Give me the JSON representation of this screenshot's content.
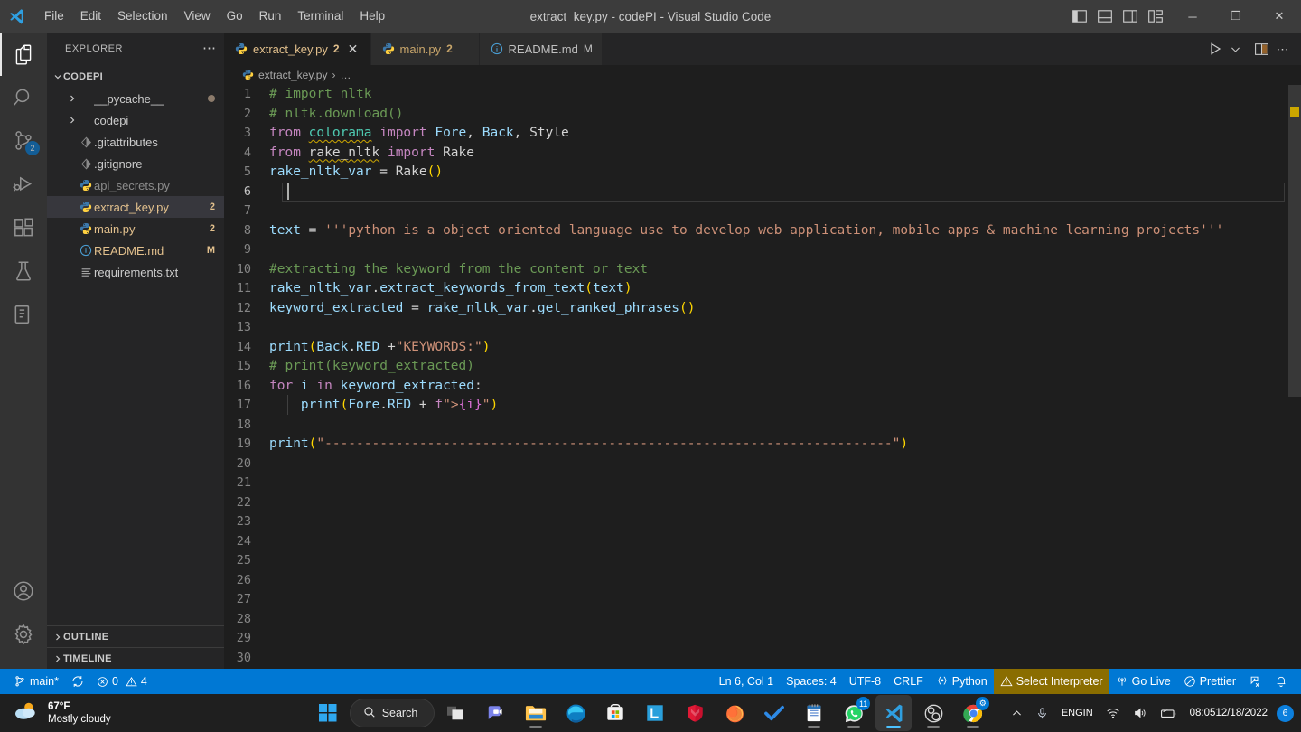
{
  "titlebar": {
    "logo_icon": "vscode-logo-icon",
    "menus": [
      "File",
      "Edit",
      "Selection",
      "View",
      "Go",
      "Run",
      "Terminal",
      "Help"
    ],
    "window_title": "extract_key.py - codePI - Visual Studio Code",
    "layout_controls": [
      {
        "name": "toggle-primary-sidebar-icon",
        "title": "Toggle Primary Side Bar"
      },
      {
        "name": "toggle-panel-icon",
        "title": "Toggle Panel"
      },
      {
        "name": "toggle-secondary-sidebar-icon",
        "title": "Toggle Secondary Side Bar"
      },
      {
        "name": "customize-layout-icon",
        "title": "Customize Layout"
      }
    ],
    "window_buttons": {
      "minimize": "─",
      "maximize": "❐",
      "close": "✕"
    }
  },
  "activitybar": {
    "items": [
      {
        "name": "explorer",
        "icon": "files-icon",
        "active": true,
        "badge": ""
      },
      {
        "name": "search",
        "icon": "search-icon",
        "active": false,
        "badge": ""
      },
      {
        "name": "source-control",
        "icon": "source-control-icon",
        "active": false,
        "badge": "2"
      },
      {
        "name": "run-and-debug",
        "icon": "run-debug-icon",
        "active": false,
        "badge": ""
      },
      {
        "name": "extensions",
        "icon": "extensions-icon",
        "active": false,
        "badge": ""
      },
      {
        "name": "testing",
        "icon": "testing-flask-icon",
        "active": false,
        "badge": ""
      },
      {
        "name": "remote-explorer",
        "icon": "remote-explorer-icon",
        "active": false,
        "badge": ""
      }
    ],
    "bottom": [
      {
        "name": "accounts",
        "icon": "account-icon"
      },
      {
        "name": "settings",
        "icon": "gear-icon"
      }
    ]
  },
  "sidebar": {
    "header_title": "EXPLORER",
    "more_actions": "⋯",
    "root_folder": "CODEPI",
    "files": [
      {
        "name": "__pycache__",
        "type": "folder",
        "icon": "folder-chevron-icon",
        "badge": "",
        "git_dot": true,
        "color": "#cccccc",
        "selected": false
      },
      {
        "name": "codepi",
        "type": "folder",
        "icon": "folder-chevron-icon",
        "badge": "",
        "git_dot": false,
        "color": "#cccccc",
        "selected": false
      },
      {
        "name": ".gitattributes",
        "type": "file",
        "icon": "git-file-icon",
        "badge": "",
        "git_dot": false,
        "color": "#cccccc",
        "selected": false
      },
      {
        "name": ".gitignore",
        "type": "file",
        "icon": "git-file-icon",
        "badge": "",
        "git_dot": false,
        "color": "#cccccc",
        "selected": false
      },
      {
        "name": "api_secrets.py",
        "type": "file",
        "icon": "python-file-icon",
        "badge": "",
        "git_dot": false,
        "color": "#8c8c8c",
        "selected": false
      },
      {
        "name": "extract_key.py",
        "type": "file",
        "icon": "python-file-icon",
        "badge": "2",
        "git_dot": false,
        "color": "#e2c08d",
        "selected": true
      },
      {
        "name": "main.py",
        "type": "file",
        "icon": "python-file-icon",
        "badge": "2",
        "git_dot": false,
        "color": "#e2c08d",
        "selected": false
      },
      {
        "name": "README.md",
        "type": "file",
        "icon": "markdown-info-icon",
        "badge": "M",
        "git_dot": false,
        "color": "#e2c08d",
        "selected": false
      },
      {
        "name": "requirements.txt",
        "type": "file",
        "icon": "text-file-icon",
        "badge": "",
        "git_dot": false,
        "color": "#cccccc",
        "selected": false
      }
    ],
    "sections": [
      "OUTLINE",
      "TIMELINE"
    ]
  },
  "editor": {
    "tabs": [
      {
        "label": "extract_key.py",
        "badge": "2",
        "badge_color": "#e2c08d",
        "icon": "python-file-icon",
        "active": true,
        "closable": true
      },
      {
        "label": "main.py",
        "badge": "2",
        "badge_color": "#e2c08d",
        "icon": "python-file-icon",
        "active": false,
        "closable": false
      },
      {
        "label": "README.md",
        "badge": "M",
        "badge_color": "#e2c08d",
        "icon": "markdown-info-icon",
        "active": false,
        "closable": false
      }
    ],
    "tab_actions": [
      {
        "name": "run-python-file-button",
        "icon": "play-icon"
      },
      {
        "name": "run-options-chevron",
        "icon": "chevron-down-icon"
      },
      {
        "name": "split-editor-right-button",
        "icon": "split-editor-icon"
      },
      {
        "name": "editor-more-actions-button",
        "icon": "ellipsis-icon"
      }
    ],
    "breadcrumb": {
      "file": "extract_key.py",
      "separator": "›",
      "tail": "…",
      "icon": "python-file-icon"
    },
    "code_lines": [
      {
        "n": 1,
        "tokens": [
          {
            "t": "# import nltk",
            "c": "t-com"
          }
        ]
      },
      {
        "n": 2,
        "tokens": [
          {
            "t": "# nltk.download()",
            "c": "t-com"
          }
        ]
      },
      {
        "n": 3,
        "tokens": [
          {
            "t": "from ",
            "c": "t-kw"
          },
          {
            "t": "colorama",
            "c": "t-mod squig"
          },
          {
            "t": " ",
            "c": "t-plain"
          },
          {
            "t": "import ",
            "c": "t-kw"
          },
          {
            "t": "Fore",
            "c": "t-var"
          },
          {
            "t": ", ",
            "c": "t-plain"
          },
          {
            "t": "Back",
            "c": "t-var"
          },
          {
            "t": ", ",
            "c": "t-plain"
          },
          {
            "t": "Style",
            "c": "t-plain"
          }
        ]
      },
      {
        "n": 4,
        "tokens": [
          {
            "t": "from ",
            "c": "t-kw"
          },
          {
            "t": "rake_nltk",
            "c": "t-plain squig"
          },
          {
            "t": " ",
            "c": "t-plain"
          },
          {
            "t": "import ",
            "c": "t-kw"
          },
          {
            "t": "Rake",
            "c": "t-plain"
          }
        ]
      },
      {
        "n": 5,
        "tokens": [
          {
            "t": "rake_nltk_var",
            "c": "t-var"
          },
          {
            "t": " = ",
            "c": "t-op"
          },
          {
            "t": "Rake",
            "c": "t-plain"
          },
          {
            "t": "()",
            "c": "t-par"
          }
        ]
      },
      {
        "n": 6,
        "tokens": []
      },
      {
        "n": 7,
        "tokens": []
      },
      {
        "n": 8,
        "tokens": [
          {
            "t": "text",
            "c": "t-var"
          },
          {
            "t": " = ",
            "c": "t-op"
          },
          {
            "t": "'''python is a object oriented language use to develop web application, mobile apps & machine learning projects'''",
            "c": "t-str"
          }
        ]
      },
      {
        "n": 9,
        "tokens": []
      },
      {
        "n": 10,
        "tokens": [
          {
            "t": "#extracting the keyword from the content or text",
            "c": "t-com"
          }
        ]
      },
      {
        "n": 11,
        "tokens": [
          {
            "t": "rake_nltk_var",
            "c": "t-var"
          },
          {
            "t": ".",
            "c": "t-plain"
          },
          {
            "t": "extract_keywords_from_text",
            "c": "t-var"
          },
          {
            "t": "(",
            "c": "t-par"
          },
          {
            "t": "text",
            "c": "t-var"
          },
          {
            "t": ")",
            "c": "t-par"
          }
        ]
      },
      {
        "n": 12,
        "tokens": [
          {
            "t": "keyword_extracted",
            "c": "t-var"
          },
          {
            "t": " = ",
            "c": "t-op"
          },
          {
            "t": "rake_nltk_var",
            "c": "t-var"
          },
          {
            "t": ".",
            "c": "t-plain"
          },
          {
            "t": "get_ranked_phrases",
            "c": "t-var"
          },
          {
            "t": "()",
            "c": "t-par"
          }
        ]
      },
      {
        "n": 13,
        "tokens": []
      },
      {
        "n": 14,
        "tokens": [
          {
            "t": "print",
            "c": "t-var"
          },
          {
            "t": "(",
            "c": "t-par"
          },
          {
            "t": "Back",
            "c": "t-var"
          },
          {
            "t": ".",
            "c": "t-plain"
          },
          {
            "t": "RED",
            "c": "t-var"
          },
          {
            "t": " +",
            "c": "t-op"
          },
          {
            "t": "\"KEYWORDS:\"",
            "c": "t-str"
          },
          {
            "t": ")",
            "c": "t-par"
          }
        ]
      },
      {
        "n": 15,
        "tokens": [
          {
            "t": "# print(keyword_extracted)",
            "c": "t-com"
          }
        ]
      },
      {
        "n": 16,
        "tokens": [
          {
            "t": "for ",
            "c": "t-kw"
          },
          {
            "t": "i",
            "c": "t-var"
          },
          {
            "t": " ",
            "c": "t-plain"
          },
          {
            "t": "in ",
            "c": "t-kw"
          },
          {
            "t": "keyword_extracted",
            "c": "t-var"
          },
          {
            "t": ":",
            "c": "t-plain"
          }
        ]
      },
      {
        "n": 17,
        "tokens": [
          {
            "t": "    ",
            "c": "t-plain"
          },
          {
            "t": "print",
            "c": "t-var"
          },
          {
            "t": "(",
            "c": "t-par"
          },
          {
            "t": "Fore",
            "c": "t-var"
          },
          {
            "t": ".",
            "c": "t-plain"
          },
          {
            "t": "RED",
            "c": "t-var"
          },
          {
            "t": " + ",
            "c": "t-op"
          },
          {
            "t": "f",
            "c": "t-kw"
          },
          {
            "t": "\">",
            "c": "t-str"
          },
          {
            "t": "{i}",
            "c": "t-par2"
          },
          {
            "t": "\"",
            "c": "t-str"
          },
          {
            "t": ")",
            "c": "t-par"
          }
        ]
      },
      {
        "n": 18,
        "tokens": []
      },
      {
        "n": 19,
        "tokens": [
          {
            "t": "print",
            "c": "t-var"
          },
          {
            "t": "(",
            "c": "t-par"
          },
          {
            "t": "\"------------------------------------------------------------------------\"",
            "c": "t-str"
          },
          {
            "t": ")",
            "c": "t-par"
          }
        ]
      },
      {
        "n": 20,
        "tokens": []
      },
      {
        "n": 21,
        "tokens": []
      },
      {
        "n": 22,
        "tokens": []
      },
      {
        "n": 23,
        "tokens": []
      },
      {
        "n": 24,
        "tokens": []
      },
      {
        "n": 25,
        "tokens": []
      },
      {
        "n": 26,
        "tokens": []
      },
      {
        "n": 27,
        "tokens": []
      },
      {
        "n": 28,
        "tokens": []
      },
      {
        "n": 29,
        "tokens": []
      },
      {
        "n": 30,
        "tokens": []
      }
    ],
    "cursor_line": 6
  },
  "statusbar": {
    "left": [
      {
        "name": "branch",
        "icon": "source-control-icon",
        "label": "main*"
      },
      {
        "name": "sync",
        "icon": "sync-icon",
        "label": ""
      },
      {
        "name": "problems",
        "icon": "error-warning-icon",
        "label": "0",
        "label2": "4"
      }
    ],
    "right": [
      {
        "name": "cursor-position",
        "label": "Ln 6, Col 1"
      },
      {
        "name": "indentation",
        "label": "Spaces: 4"
      },
      {
        "name": "encoding",
        "label": "UTF-8"
      },
      {
        "name": "eol",
        "label": "CRLF"
      },
      {
        "name": "language-mode",
        "label": "Python",
        "icon": "braces-icon"
      },
      {
        "name": "select-interpreter",
        "label": "Select Interpreter",
        "icon": "warning-icon",
        "highlight": true
      },
      {
        "name": "go-live",
        "label": "Go Live",
        "icon": "broadcast-icon"
      },
      {
        "name": "prettier",
        "label": "Prettier",
        "icon": "prettier-check-icon"
      },
      {
        "name": "live-share",
        "label": "",
        "icon": "live-share-icon"
      },
      {
        "name": "notifications",
        "label": "",
        "icon": "bell-icon"
      }
    ]
  },
  "taskbar": {
    "weather": {
      "temp": "67°F",
      "condition": "Mostly cloudy",
      "icon": "sun-cloud-icon"
    },
    "start_icon": "windows-start-icon",
    "search_label": "Search",
    "search_icon": "search-icon",
    "apps": [
      {
        "name": "task-view",
        "icon": "task-view-icon",
        "open": false,
        "active": false,
        "badge": ""
      },
      {
        "name": "microsoft-teams",
        "icon": "teams-chat-icon",
        "open": false,
        "active": false,
        "badge": ""
      },
      {
        "name": "file-explorer",
        "icon": "folder-icon",
        "open": true,
        "active": false,
        "badge": ""
      },
      {
        "name": "microsoft-edge",
        "icon": "edge-icon",
        "open": false,
        "active": false,
        "badge": ""
      },
      {
        "name": "microsoft-store",
        "icon": "store-icon",
        "open": false,
        "active": false,
        "badge": ""
      },
      {
        "name": "linkedin",
        "icon": "l-app-icon",
        "open": false,
        "active": false,
        "badge": ""
      },
      {
        "name": "mcafee",
        "icon": "shield-icon",
        "open": false,
        "active": false,
        "badge": ""
      },
      {
        "name": "firefox",
        "icon": "firefox-icon",
        "open": true,
        "active": false,
        "badge": ""
      },
      {
        "name": "todoist",
        "icon": "checkmark-icon",
        "open": false,
        "active": false,
        "badge": ""
      },
      {
        "name": "notepad",
        "icon": "notepad-icon",
        "open": true,
        "active": false,
        "badge": ""
      },
      {
        "name": "whatsapp",
        "icon": "whatsapp-icon",
        "open": true,
        "active": false,
        "badge": "11"
      },
      {
        "name": "visual-studio-code",
        "icon": "vscode-icon",
        "open": true,
        "active": true,
        "badge": ""
      },
      {
        "name": "obs-studio",
        "icon": "obs-icon",
        "open": true,
        "active": false,
        "badge": ""
      },
      {
        "name": "google-chrome",
        "icon": "chrome-icon",
        "open": true,
        "active": false,
        "badge": "⚙"
      }
    ],
    "tray": {
      "overflow_icon": "chevron-up-icon",
      "mic_icon": "microphone-icon",
      "language": {
        "line1": "ENG",
        "line2": "IN"
      },
      "wifi_icon": "wifi-icon",
      "volume_icon": "speaker-icon",
      "battery_icon": "battery-icon",
      "time": "08:05",
      "date": "12/18/2022",
      "notification_count": "6"
    }
  },
  "colors": {
    "accent": "#0078d4",
    "editor_bg": "#1e1e1e",
    "sidebar_bg": "#252526",
    "activitybar_bg": "#333333",
    "titlebar_bg": "#3c3c3c",
    "taskbar_bg": "#1f1f1f",
    "warning": "#cca700",
    "modified": "#e2c08d"
  }
}
